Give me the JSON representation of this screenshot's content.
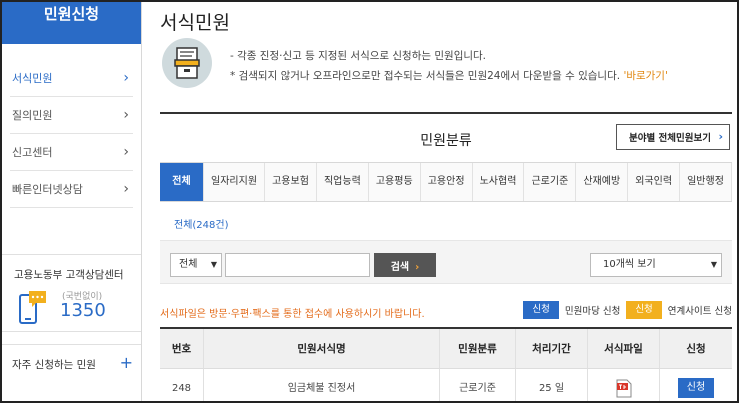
{
  "sidebar": {
    "title": "민원신청",
    "items": [
      {
        "label": "서식민원",
        "active": true
      },
      {
        "label": "질의민원",
        "active": false
      },
      {
        "label": "신고센터",
        "active": false
      },
      {
        "label": "빠른인터넷상담",
        "active": false
      }
    ],
    "call_center": {
      "title": "고용노동부 고객상담센터",
      "sub": "(국번없이)",
      "number": "1350"
    },
    "frequent": {
      "label": "자주 신청하는 민원",
      "icon": "plus-icon"
    }
  },
  "main": {
    "title": "서식민원",
    "intro": {
      "line1": "- 각종 진정·신고 등 지정된 서식으로 신청하는 민원입니다.",
      "line2": "* 검색되지 않거나 오프라인으로만 접수되는 서식들은 민원24에서 다운받을 수 있습니다.",
      "link": "'바로가기'"
    },
    "category_title": "민원분류",
    "all_button": "분야별 전체민원보기",
    "tabs": [
      "전체",
      "일자리지원",
      "고용보험",
      "직업능력",
      "고용평등",
      "고용안정",
      "노사협력",
      "근로기준",
      "산재예방",
      "외국인력",
      "일반행정"
    ],
    "subtab": "전체(248건)",
    "search": {
      "type_value": "전체",
      "input_value": "",
      "button": "검색",
      "count_value": "10개씩 보기"
    },
    "notice": "서식파일은 방문·우편·팩스를 통한 접수에 사용하시기 바랍니다.",
    "legend": [
      {
        "badge": "신청",
        "color": "#2a6bc6",
        "label": "민원마당 신청"
      },
      {
        "badge": "신청",
        "color": "#f2b01e",
        "label": "연계사이트 신청"
      }
    ],
    "table": {
      "headers": [
        "번호",
        "민원서식명",
        "민원분류",
        "처리기간",
        "서식파일",
        "신청"
      ],
      "rows": [
        {
          "no": "248",
          "name": "임금체불 진정서",
          "category": "근로기준",
          "period": "25 일",
          "file_icon": "hwp-file-icon",
          "apply": "신청"
        }
      ]
    }
  },
  "colors": {
    "accent": "#2a6bc6",
    "highlight": "#e36b1a",
    "link": "#e0860f"
  }
}
